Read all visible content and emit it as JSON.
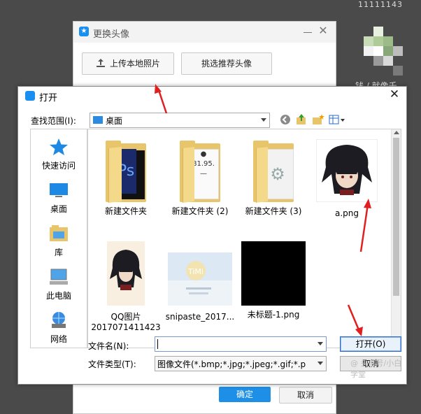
{
  "background": {
    "top_text": "11111143",
    "right_text": "钱 / 就像千"
  },
  "qq_window": {
    "title": "更换头像",
    "upload_label": "上传本地照片",
    "recommend_label": "挑选推荐头像",
    "ok_label": "确定",
    "cancel_label": "取消",
    "accent_color": "#1e8fe6"
  },
  "dialog": {
    "title": "打开",
    "look_in_label": "查找范围(I):",
    "look_in_value": "桌面",
    "places": [
      {
        "label": "快速访问",
        "icon": "star-icon"
      },
      {
        "label": "桌面",
        "icon": "desktop-icon"
      },
      {
        "label": "库",
        "icon": "library-icon"
      },
      {
        "label": "此电脑",
        "icon": "computer-icon"
      },
      {
        "label": "网络",
        "icon": "network-icon"
      }
    ],
    "files": [
      {
        "name": "新建文件夹",
        "type": "folder"
      },
      {
        "name": "新建文件夹 (2)",
        "type": "folder"
      },
      {
        "name": "新建文件夹 (3)",
        "type": "folder"
      },
      {
        "name": "a.png",
        "type": "image"
      },
      {
        "name": "QQ图片",
        "name2": "2017071411423",
        "type": "image"
      },
      {
        "name": "snipaste_2017...",
        "type": "image"
      },
      {
        "name": "未标题-1.png",
        "type": "image"
      }
    ],
    "filename_label": "文件名(N):",
    "filename_value": "",
    "filetype_label": "文件类型(T):",
    "filetype_value": "图像文件(*.bmp;*.jpg;*.jpeg;*.gif;*.p",
    "open_label": "打开(O)",
    "cancel_label": "取消",
    "watermark": "@ 头条号/小白学堂"
  }
}
